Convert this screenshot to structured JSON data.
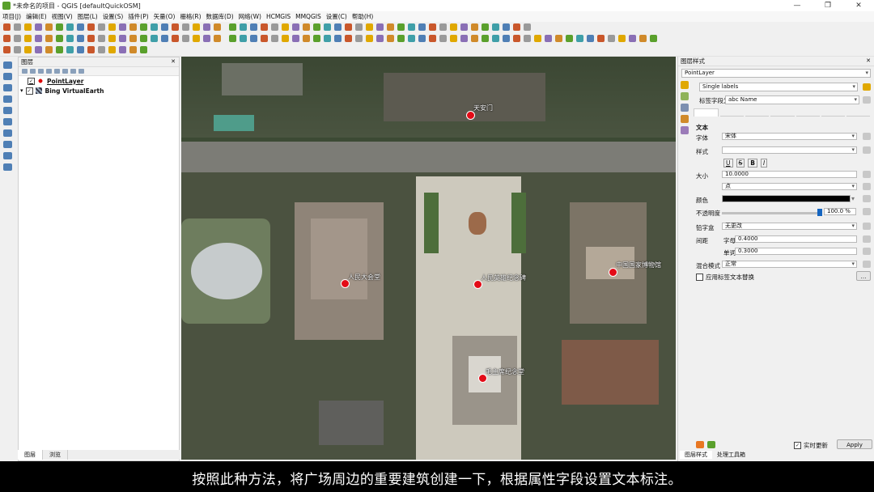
{
  "window": {
    "title": "*未命名的项目 - QGIS [defaultQuickOSM]"
  },
  "window_controls": {
    "minimize": "—",
    "maximize": "❐",
    "close": "✕"
  },
  "menu": [
    "项目(J)",
    "编辑(E)",
    "视图(V)",
    "图层(L)",
    "设置(S)",
    "插件(P)",
    "矢量(O)",
    "栅格(R)",
    "数据库(D)",
    "网络(W)",
    "HCMGIS",
    "MMQGIS",
    "设置(C)",
    "帮助(H)"
  ],
  "layers_panel": {
    "title": "图层",
    "layers": [
      {
        "name": "PointLayer",
        "checked": true,
        "icon": "point-layer-icon"
      },
      {
        "name": "Bing VirtualEarth",
        "checked": true,
        "icon": "raster-layer-icon"
      }
    ],
    "tabs": [
      "图层",
      "浏览"
    ]
  },
  "map": {
    "labels": [
      "天安门",
      "人民大会堂",
      "人民英雄纪念碑",
      "中国国家博物馆",
      "毛主席纪念堂"
    ],
    "point_color": "#e30b17"
  },
  "style_panel": {
    "title": "图层样式",
    "layer": "PointLayer",
    "renderer": "Single labels",
    "label_with_caption": "标签字段为",
    "label_field": "abc Name",
    "section": "文本",
    "font_caption": "字体",
    "font_value": "宋体",
    "style_caption": "样式",
    "size_caption": "大小",
    "size_value": "10.0000",
    "unit_value": "点",
    "color_caption": "颜色",
    "color_value": "#000000",
    "opacity_caption": "不透明度",
    "opacity_value": "100.0 %",
    "case_caption": "铅字盒",
    "case_value": "无更改",
    "spacing_caption": "间距",
    "letter_caption": "字母",
    "letter_value": "0.4000",
    "word_caption": "单词",
    "word_value": "0.3000",
    "blend_caption": "混合模式",
    "blend_value": "正常",
    "substitute_caption": "应用标签文本替换",
    "live_update": "实时更新",
    "apply": "Apply",
    "tabs": [
      "图层样式",
      "处理工具箱"
    ]
  },
  "subtitle": "按照此种方法，将广场周边的重要建筑创建一下，根据属性字段设置文本标注。"
}
